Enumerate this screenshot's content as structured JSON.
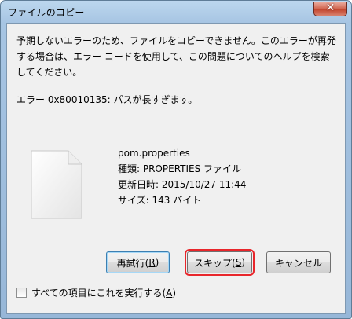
{
  "window": {
    "title": "ファイルのコピー",
    "close_glyph": "✕"
  },
  "message": {
    "line1": "予期しないエラーのため、ファイルをコピーできません。このエラーが再発",
    "line2": "する場合は、エラー コードを使用して、この問題についてのヘルプを検索",
    "line3": "してください。"
  },
  "error": {
    "text": "エラー 0x80010135: パスが長すぎます。"
  },
  "file": {
    "icon": "document-icon",
    "name": "pom.properties",
    "type": "種類: PROPERTIES ファイル",
    "modified": "更新日時: 2015/10/27 11:44",
    "size": "サイズ: 143 バイト"
  },
  "buttons": {
    "retry": {
      "label": "再試行(",
      "key": "R",
      "end": ")"
    },
    "skip": {
      "label": "スキップ(",
      "key": "S",
      "end": ")"
    },
    "cancel": {
      "label": "キャンセル"
    }
  },
  "checkbox": {
    "label": "すべての項目にこれを実行する(",
    "key": "A",
    "end": ")",
    "checked": false
  },
  "colors": {
    "highlight": "#e8262b",
    "close_button": "#c2432b"
  }
}
